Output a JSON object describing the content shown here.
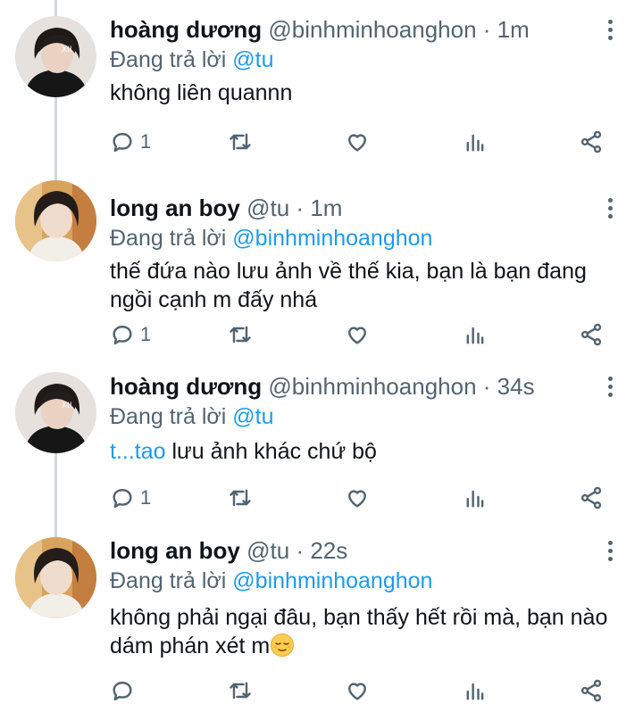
{
  "labels": {
    "replying_to": "Đang trả lời"
  },
  "tweets": [
    {
      "name": "hoàng dương",
      "handle": "@binhminhoanghon",
      "time": "· 1m",
      "reply_to": "@tu",
      "text": "không liên quannn",
      "reply_count": "1",
      "avatar": "hoang-duong-avatar"
    },
    {
      "name": "long an boy",
      "handle": "@tu",
      "time": "· 1m",
      "reply_to": "@binhminhoanghon",
      "text": "thế đứa nào lưu ảnh về thế kia, bạn là bạn đang ngồi cạnh m đấy nhá",
      "reply_count": "1",
      "avatar": "long-an-boy-avatar"
    },
    {
      "name": "hoàng dương",
      "handle": "@binhminhoanghon",
      "time": "· 34s",
      "reply_to": "@tu",
      "text_mention": "t...tao",
      "text": " lưu ảnh khác chứ bộ",
      "reply_count": "1",
      "avatar": "hoang-duong-avatar"
    },
    {
      "name": "long an boy",
      "handle": "@tu",
      "time": "· 22s",
      "reply_to": "@binhminhoanghon",
      "text": "không phải ngại đâu, bạn thấy hết rồi mà, bạn nào dám phán xét m",
      "text_emoji": "relieved-face-emoji",
      "reply_count": "",
      "avatar": "long-an-boy-avatar"
    }
  ],
  "colors": {
    "link": "#1d9bf0",
    "muted": "#536471",
    "text": "#0f1419",
    "thread_line": "#cfd9de"
  }
}
